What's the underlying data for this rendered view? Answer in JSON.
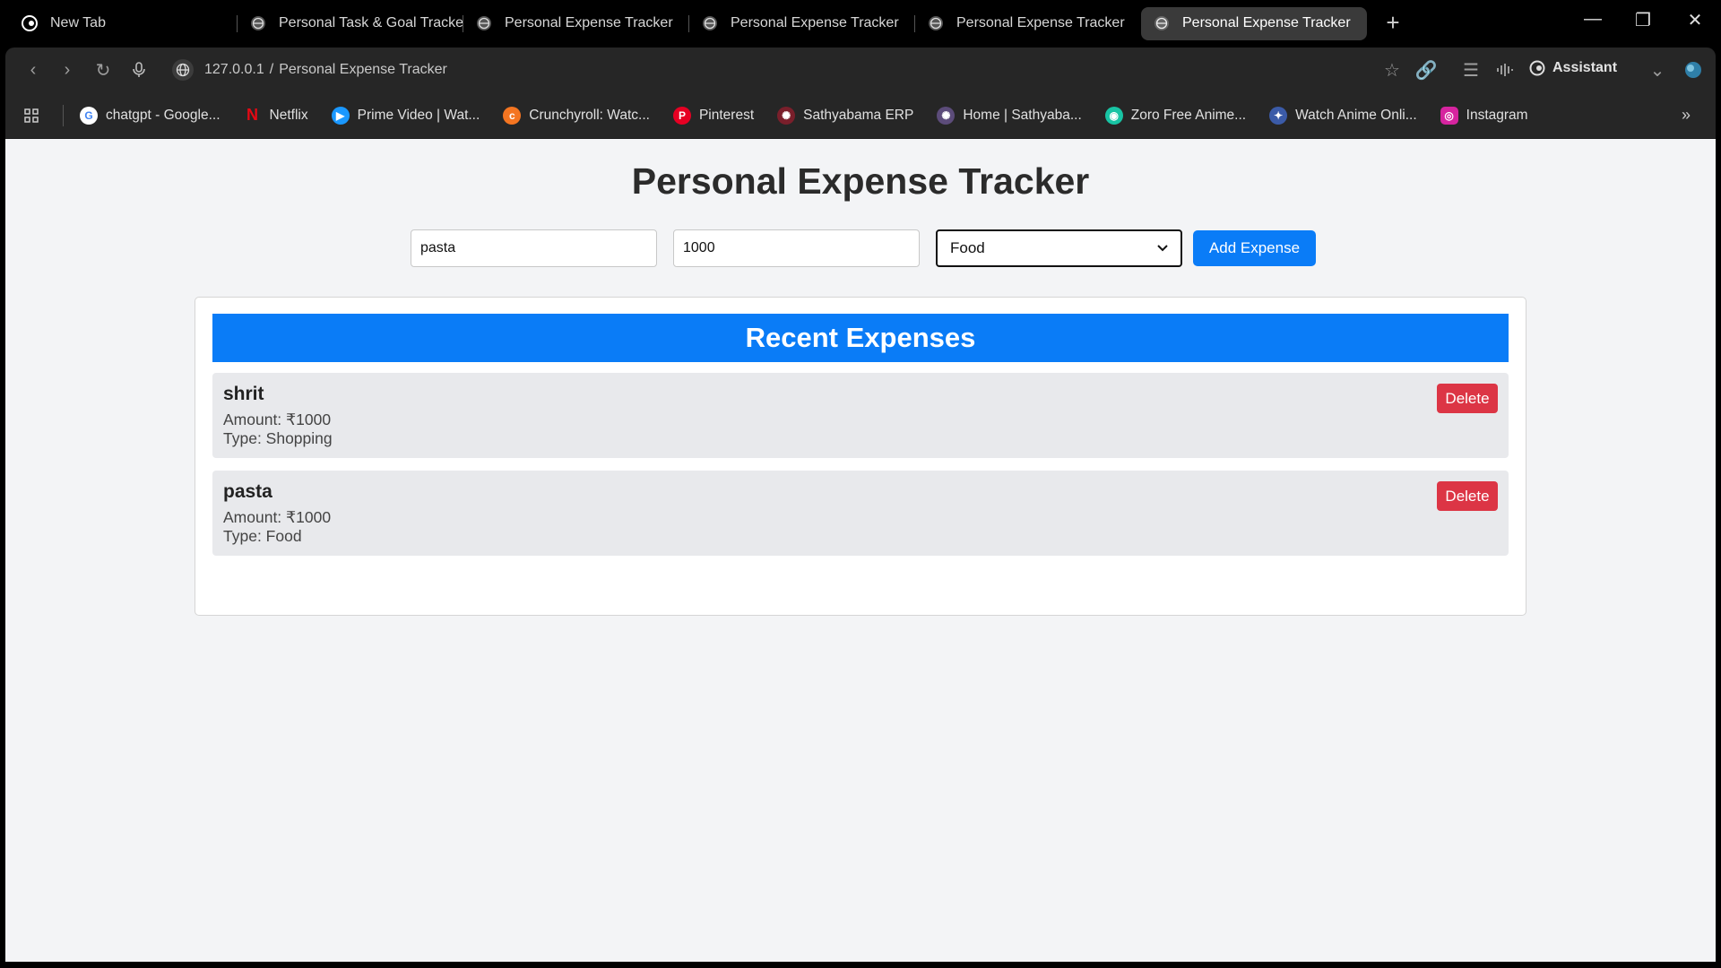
{
  "browser": {
    "tabs": [
      {
        "title": "New Tab",
        "active": false
      },
      {
        "title": "Personal Task & Goal Tracker",
        "active": false
      },
      {
        "title": "Personal Expense Tracker",
        "active": false
      },
      {
        "title": "Personal Expense Tracker",
        "active": false
      },
      {
        "title": "Personal Expense Tracker",
        "active": false
      },
      {
        "title": "Personal Expense Tracker",
        "active": true
      }
    ],
    "address": {
      "host": "127.0.0.1",
      "separator": "/",
      "page": "Personal Expense Tracker"
    },
    "assistant_label": "Assistant",
    "bookmarks": [
      {
        "label": "chatgpt - Google...",
        "icon": "google-icon",
        "color": "#ffffff"
      },
      {
        "label": "Netflix",
        "icon": "netflix-icon",
        "color": "#e50914"
      },
      {
        "label": "Prime Video | Wat...",
        "icon": "prime-video-icon",
        "color": "#1a98ff"
      },
      {
        "label": "Crunchyroll: Watc...",
        "icon": "crunchyroll-icon",
        "color": "#f47521"
      },
      {
        "label": "Pinterest",
        "icon": "pinterest-icon",
        "color": "#e60023"
      },
      {
        "label": "Sathyabama ERP",
        "icon": "sathyabama-icon",
        "color": "#7a1f2b"
      },
      {
        "label": "Home | Sathyaba...",
        "icon": "sathyabama-home-icon",
        "color": "#5c4c7a"
      },
      {
        "label": "Zoro Free Anime...",
        "icon": "zoro-icon",
        "color": "#18c4a4"
      },
      {
        "label": "Watch Anime Onli...",
        "icon": "anime-icon",
        "color": "#3b5ba8"
      },
      {
        "label": "Instagram",
        "icon": "instagram-icon",
        "color": "#d6249f"
      }
    ]
  },
  "app": {
    "title": "Personal Expense Tracker",
    "form": {
      "name_value": "pasta",
      "amount_value": "1000",
      "category_value": "Food",
      "add_label": "Add Expense"
    },
    "list_header": "Recent Expenses",
    "expenses": [
      {
        "name": "shrit",
        "amount": "Amount: ₹1000",
        "type": "Type: Shopping",
        "delete_label": "Delete"
      },
      {
        "name": "pasta",
        "amount": "Amount: ₹1000",
        "type": "Type: Food",
        "delete_label": "Delete"
      }
    ],
    "colors": {
      "primary": "#0a7cf7",
      "danger": "#dc3545",
      "background": "#f3f4f6"
    }
  }
}
